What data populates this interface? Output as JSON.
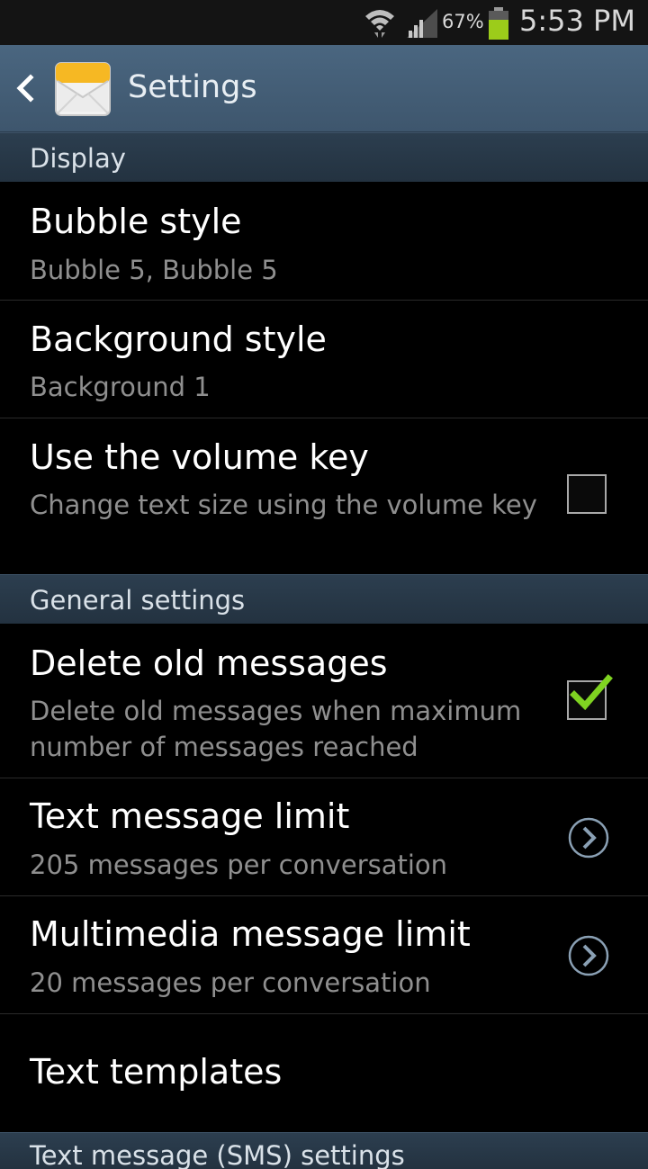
{
  "status_bar": {
    "battery_percent": "67%",
    "time": "5:53 PM",
    "icons": [
      "wifi-icon",
      "signal-icon",
      "battery-icon"
    ],
    "battery_color": "#9ccc1a"
  },
  "action_bar": {
    "title": "Settings",
    "back_icon": "back-arrow-icon",
    "app_icon": "messaging-envelope-icon"
  },
  "sections": {
    "display": "Display",
    "general": "General settings",
    "sms": "Text message (SMS) settings"
  },
  "rows": {
    "bubble_style": {
      "title": "Bubble style",
      "summary": "Bubble 5, Bubble 5"
    },
    "background_style": {
      "title": "Background style",
      "summary": "Background 1"
    },
    "volume_key": {
      "title": "Use the volume key",
      "summary": "Change text size using the volume key",
      "checked": false
    },
    "delete_old": {
      "title": "Delete old messages",
      "summary": "Delete old messages when maximum number of messages reached",
      "checked": true
    },
    "text_limit": {
      "title": "Text message limit",
      "summary": "205 messages per conversation"
    },
    "mms_limit": {
      "title": "Multimedia message limit",
      "summary": "20 messages per conversation"
    },
    "templates": {
      "title": "Text templates"
    }
  },
  "colors": {
    "action_bar": "#45607a",
    "section_header": "#283949",
    "check_green": "#7fd321",
    "summary_text": "#8f8f8f"
  }
}
